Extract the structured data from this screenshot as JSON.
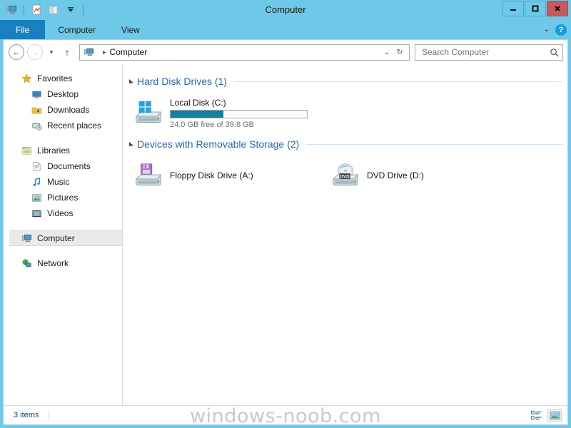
{
  "window": {
    "title": "Computer",
    "controls": {
      "minimize": "−",
      "maximize": "❐",
      "close": "✕"
    },
    "quick_access": [
      {
        "name": "computer-icon",
        "label": "Computer"
      },
      {
        "name": "properties-icon",
        "label": "Properties"
      },
      {
        "name": "new-folder-icon",
        "label": "New folder"
      },
      {
        "name": "customize-qat-icon",
        "label": "Customize Quick Access Toolbar"
      }
    ]
  },
  "ribbon": {
    "tabs": [
      {
        "label": "File",
        "selected": true
      },
      {
        "label": "Computer",
        "selected": false
      },
      {
        "label": "View",
        "selected": false
      }
    ],
    "expand_label": "⌄",
    "help_label": "?"
  },
  "address": {
    "back_label": "←",
    "forward_label": "→",
    "history_label": "▾",
    "up_label": "↑",
    "crumb_icon": "computer-icon",
    "crumbs": [
      "Computer"
    ],
    "crumb_arrow": "▸",
    "dropdown_label": "⌄",
    "refresh_label": "↻"
  },
  "search": {
    "placeholder": "Search Computer",
    "value": "",
    "icon": "search-icon"
  },
  "sidebar": {
    "groups": [
      {
        "header": {
          "label": "Favorites",
          "icon": "star-icon"
        },
        "items": [
          {
            "label": "Desktop",
            "icon": "desktop-icon"
          },
          {
            "label": "Downloads",
            "icon": "downloads-folder-icon"
          },
          {
            "label": "Recent places",
            "icon": "recent-places-icon"
          }
        ]
      },
      {
        "header": {
          "label": "Libraries",
          "icon": "libraries-icon"
        },
        "items": [
          {
            "label": "Documents",
            "icon": "document-icon"
          },
          {
            "label": "Music",
            "icon": "music-note-icon"
          },
          {
            "label": "Pictures",
            "icon": "pictures-icon"
          },
          {
            "label": "Videos",
            "icon": "videos-icon"
          }
        ]
      },
      {
        "header": {
          "label": "Computer",
          "icon": "computer-icon",
          "selected": true
        },
        "items": []
      },
      {
        "header": {
          "label": "Network",
          "icon": "network-icon"
        },
        "items": []
      }
    ]
  },
  "content": {
    "groups": [
      {
        "title": "Hard Disk Drives (1)",
        "expanded": true,
        "items": [
          {
            "name": "Local Disk (C:)",
            "icon": "system-hard-drive-icon",
            "has_meter": true,
            "meter_percent": 39,
            "meter_fill_color": "#12809f",
            "sub": "24.0 GB free of 39.6 GB"
          }
        ]
      },
      {
        "title": "Devices with Removable Storage (2)",
        "expanded": true,
        "items": [
          {
            "name": "Floppy Disk Drive (A:)",
            "icon": "floppy-drive-icon",
            "has_meter": false,
            "sub": ""
          },
          {
            "name": "DVD Drive (D:)",
            "icon": "dvd-drive-icon",
            "has_meter": false,
            "sub": ""
          }
        ]
      }
    ]
  },
  "statusbar": {
    "items_count": "3 items",
    "views": [
      {
        "name": "details-view-button",
        "label": "Details view",
        "active": false
      },
      {
        "name": "large-icons-view-button",
        "label": "Large icons view",
        "active": true
      }
    ]
  },
  "watermark": {
    "text": "windows-noob.com"
  },
  "colors": {
    "titlebar": "#6ec8e8",
    "file_tab": "#1a7fc1",
    "close_button": "#c75b5b",
    "group_header_text": "#2a66b0",
    "meter_fill": "#12809f"
  }
}
